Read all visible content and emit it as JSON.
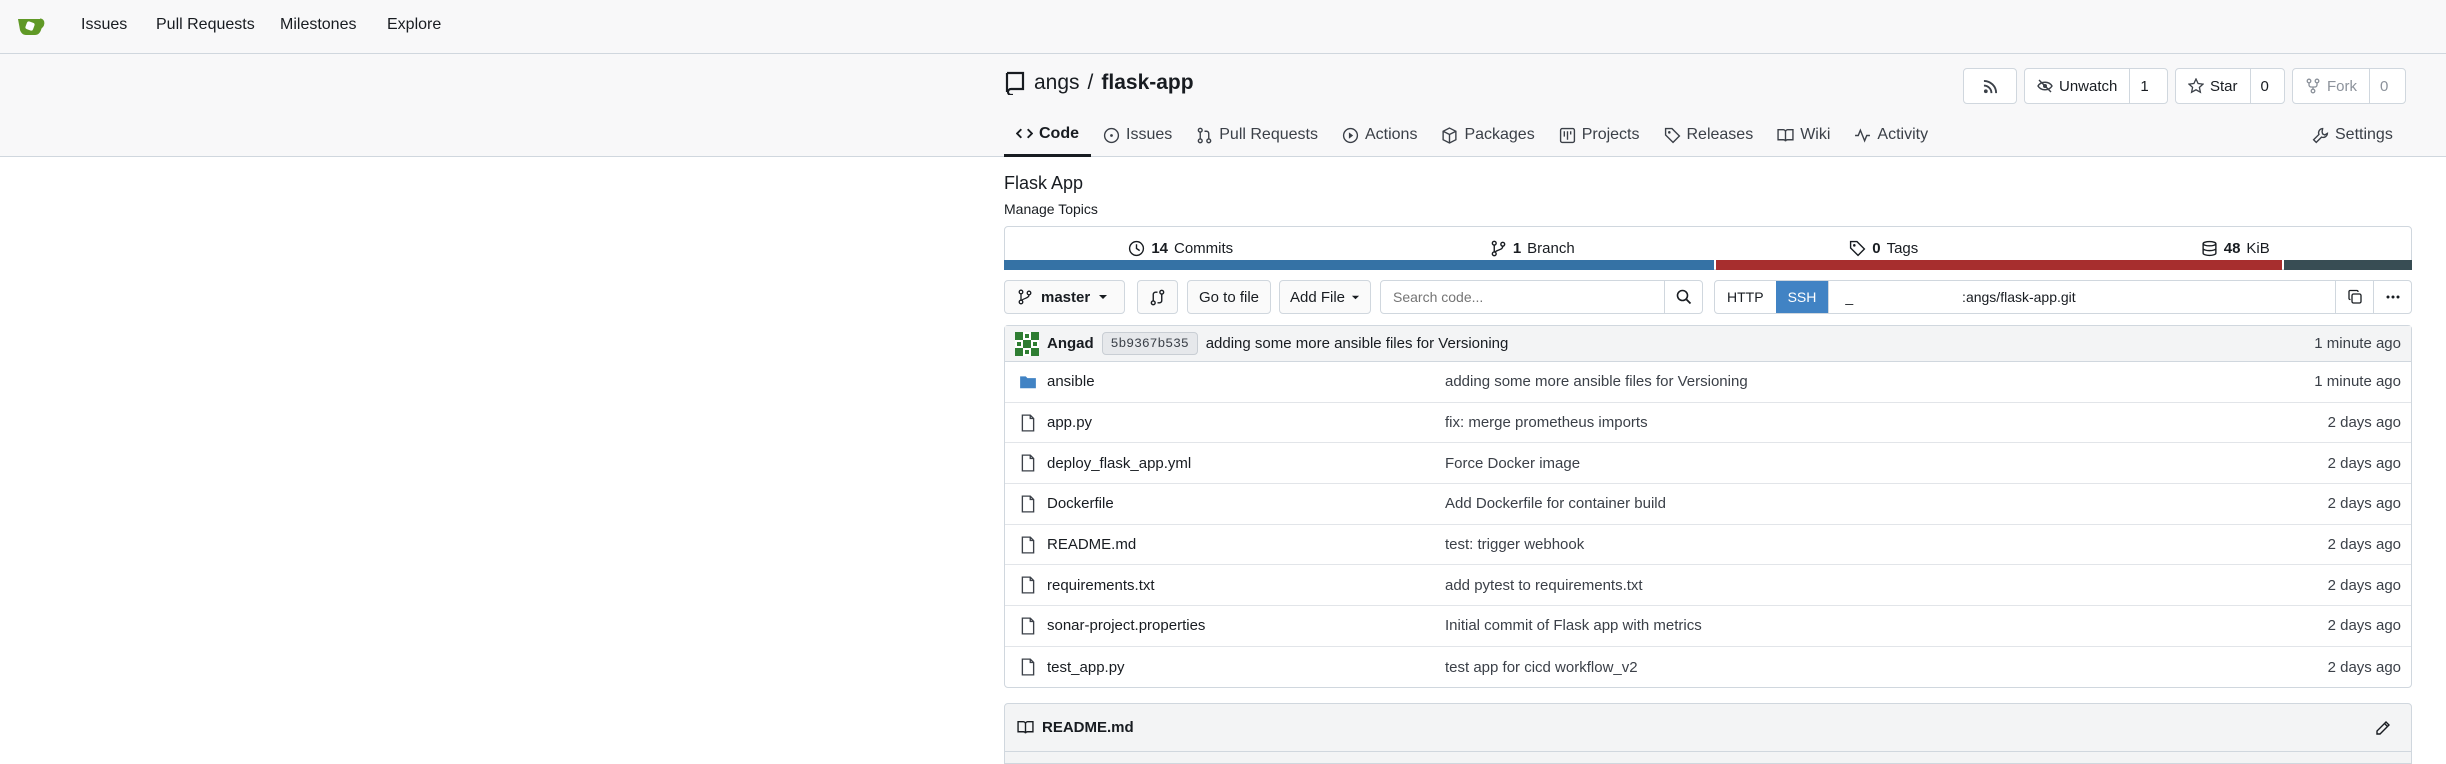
{
  "nav": {
    "links": [
      "Issues",
      "Pull Requests",
      "Milestones",
      "Explore"
    ]
  },
  "repo": {
    "owner": "angs",
    "separator": "/",
    "name": "flask-app",
    "description": "Flask App",
    "manage_topics": "Manage Topics"
  },
  "header_buttons": {
    "unwatch_label": "Unwatch",
    "watch_count": "1",
    "star_label": "Star",
    "star_count": "0",
    "fork_label": "Fork",
    "fork_count": "0"
  },
  "tabs": {
    "code": "Code",
    "issues": "Issues",
    "pulls": "Pull Requests",
    "actions": "Actions",
    "packages": "Packages",
    "projects": "Projects",
    "releases": "Releases",
    "wiki": "Wiki",
    "activity": "Activity",
    "settings": "Settings"
  },
  "stats": {
    "commits_count": "14",
    "commits_label": "Commits",
    "branch_count": "1",
    "branch_label": "Branch",
    "tags_count": "0",
    "tags_label": "Tags",
    "size_value": "48",
    "size_unit": "KiB"
  },
  "language_bar": {
    "colors": [
      "#3572A5",
      "#a72e2e",
      "#384d54"
    ],
    "fractions": [
      0.506,
      0.403,
      0.091
    ]
  },
  "toolbar": {
    "branch": "master",
    "go_to_file": "Go to file",
    "add_file": "Add File",
    "search_placeholder": "Search code...",
    "http_label": "HTTP",
    "ssh_label": "SSH",
    "clone_url": "_                            :angs/flask-app.git"
  },
  "latest_commit": {
    "author": "Angad",
    "sha": "5b9367b535",
    "message": "adding some more ansible files for Versioning",
    "time": "1 minute ago"
  },
  "files": [
    {
      "icon": "folder-icon",
      "name": "ansible",
      "message": "adding some more ansible files for Versioning",
      "time": "1 minute ago"
    },
    {
      "icon": "file-icon",
      "name": "app.py",
      "message": "fix: merge prometheus imports",
      "time": "2 days ago"
    },
    {
      "icon": "file-icon",
      "name": "deploy_flask_app.yml",
      "message": "Force Docker image",
      "time": "2 days ago"
    },
    {
      "icon": "file-icon",
      "name": "Dockerfile",
      "message": "Add Dockerfile for container build",
      "time": "2 days ago"
    },
    {
      "icon": "file-icon",
      "name": "README.md",
      "message": "test: trigger webhook",
      "time": "2 days ago"
    },
    {
      "icon": "file-icon",
      "name": "requirements.txt",
      "message": "add pytest to requirements.txt",
      "time": "2 days ago"
    },
    {
      "icon": "file-icon",
      "name": "sonar-project.properties",
      "message": "Initial commit of Flask app with metrics",
      "time": "2 days ago"
    },
    {
      "icon": "file-icon",
      "name": "test_app.py",
      "message": "test app for cicd workflow_v2",
      "time": "2 days ago"
    }
  ],
  "readme": {
    "title": "README.md"
  }
}
